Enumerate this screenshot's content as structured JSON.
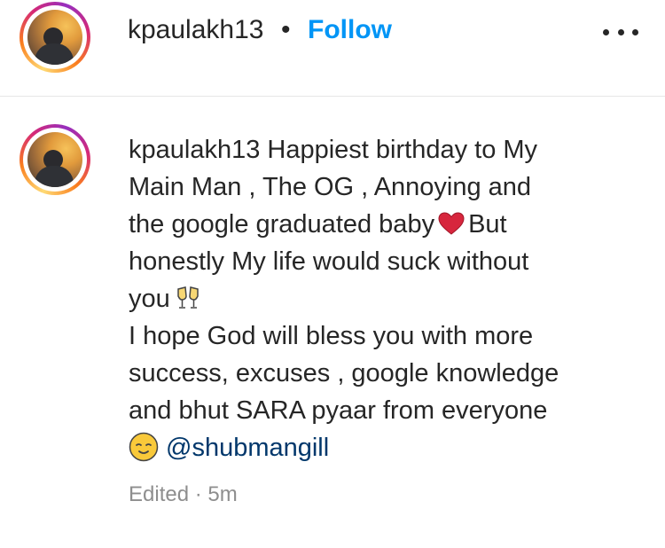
{
  "post": {
    "username": "kpaulakh13",
    "separator": "•",
    "follow_label": "Follow",
    "more_icon": "more-horizontal-icon"
  },
  "comment": {
    "username": "kpaulakh13",
    "line1": "Happiest birthday to My",
    "line2": "Main Man , The OG , Annoying and",
    "line3a": "the google graduated baby",
    "line3b": "But",
    "line4": "honestly My life would suck without",
    "line5": "you",
    "line6": "I hope God will bless you with more",
    "line7": "success, excuses , google knowledge",
    "line8": "and bhut SARA pyaar from everyone",
    "mention": "@shubmangill",
    "meta": "Edited · 5m"
  },
  "colors": {
    "accent": "#0095f6",
    "mention": "#00376b",
    "muted": "#8e8e8e",
    "divider": "#e6e6e6"
  }
}
